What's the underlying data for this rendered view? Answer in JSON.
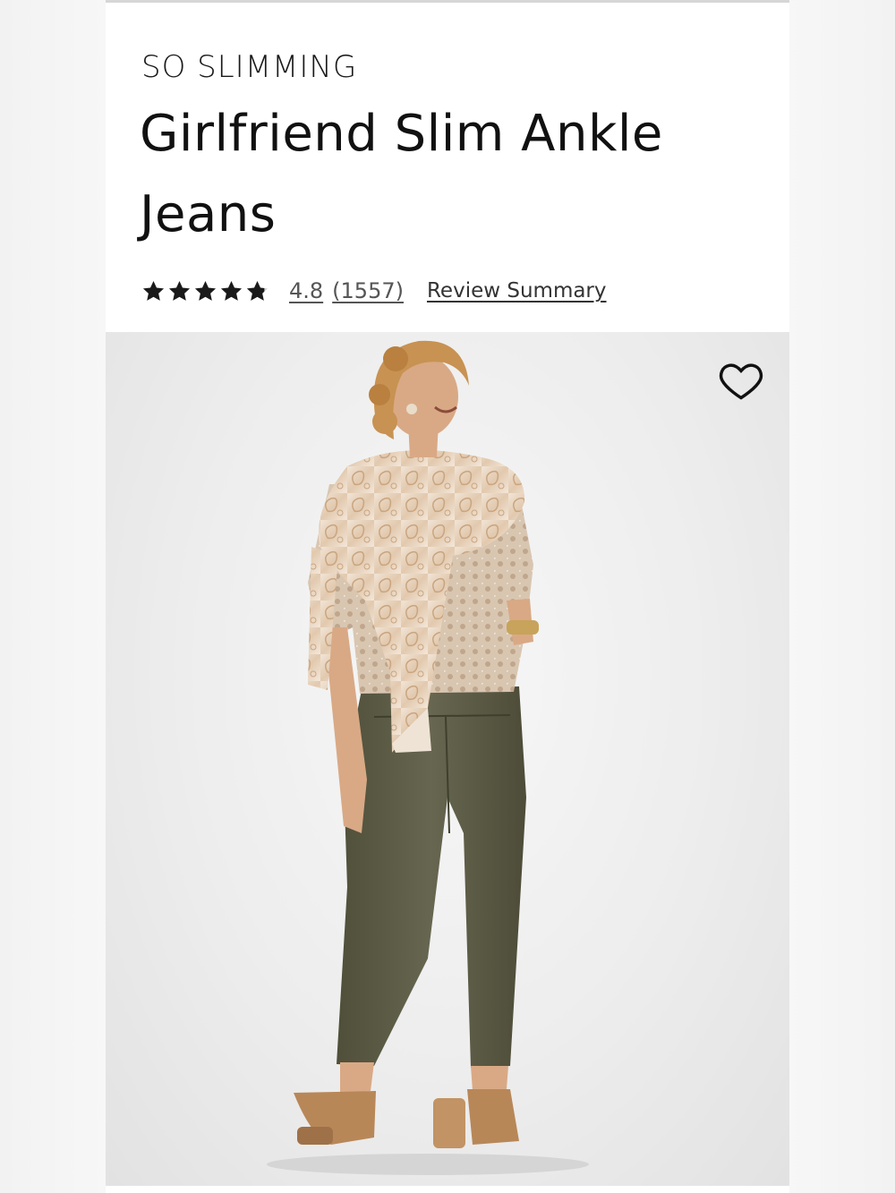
{
  "product": {
    "brand_line": "SO SLIMMING",
    "title": "Girlfriend Slim Ankle Jeans"
  },
  "rating": {
    "value": "4.8",
    "count": "(1557)",
    "stars_fraction": 0.96,
    "review_summary_label": "Review Summary"
  },
  "image": {
    "alt": "Model wearing olive Girlfriend Slim Ankle Jeans with paisley scarf and lace top",
    "favorite_icon": "heart-outline-icon"
  },
  "colors": {
    "jeans": "#5d5c45",
    "scarf": "#e6d2bd",
    "top": "#d8c5b1",
    "skin": "#d9a985",
    "hair": "#c89252",
    "sandals": "#b88758"
  }
}
